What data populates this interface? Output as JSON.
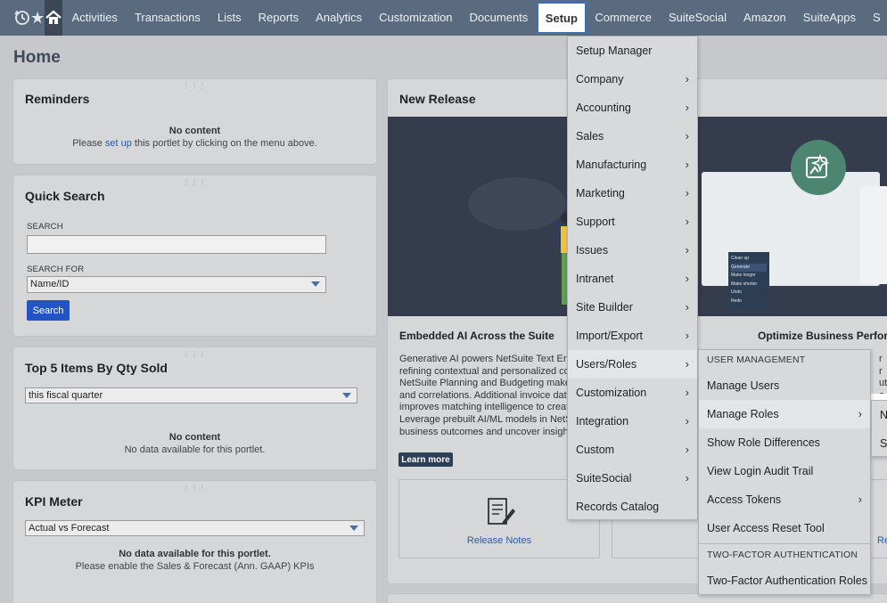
{
  "nav": {
    "items": [
      "Activities",
      "Transactions",
      "Lists",
      "Reports",
      "Analytics",
      "Customization",
      "Documents",
      "Setup",
      "Commerce",
      "SuiteSocial",
      "Amazon",
      "SuiteApps",
      "S"
    ],
    "active": "Setup"
  },
  "page": {
    "title": "Home"
  },
  "reminders": {
    "title": "Reminders",
    "no_content": "No content",
    "hint_prefix": "Please ",
    "hint_link": "set up",
    "hint_suffix": " this portlet by clicking on the menu above."
  },
  "quick_search": {
    "title": "Quick Search",
    "search_label": "SEARCH",
    "search_value": "",
    "search_for_label": "SEARCH FOR",
    "search_for_value": "Name/ID",
    "button": "Search"
  },
  "top_items": {
    "title": "Top 5 Items By Qty Sold",
    "period": "this fiscal quarter",
    "no_content": "No content",
    "no_data": "No data available for this portlet."
  },
  "kpi": {
    "title": "KPI Meter",
    "select": "Actual vs Forecast",
    "no_data": "No data available for this portlet.",
    "hint": "Please enable the Sales & Forecast (Ann. GAAP) KPIs"
  },
  "new_release": {
    "title": "New Release",
    "popup_items": [
      "Clean up",
      "Generate",
      "Make longer",
      "Make shorter",
      "Undo",
      "Redo"
    ],
    "col1_title": "Embedded AI Across the Suite",
    "col1_lines": [
      "Generative AI powers NetSuite Text Enh",
      "refining contextual and personalized co",
      "NetSuite Planning and Budgeting make",
      "and correlations. Additional invoice dat",
      "improves matching intelligence to creat",
      "Leverage prebuilt AI/ML models in NetS",
      "business outcomes and uncover insight"
    ],
    "col2_title": "Optimize Business Perforr",
    "col2_lines": [
      "r",
      "r",
      "ution",
      "e Cl"
    ],
    "learn_more": "Learn more",
    "release_notes": "Release Notes",
    "card3_text": "Re"
  },
  "setup_menu": {
    "items": [
      {
        "label": "Setup Manager",
        "sub": false
      },
      {
        "label": "Company",
        "sub": true
      },
      {
        "label": "Accounting",
        "sub": true
      },
      {
        "label": "Sales",
        "sub": true
      },
      {
        "label": "Manufacturing",
        "sub": true
      },
      {
        "label": "Marketing",
        "sub": true
      },
      {
        "label": "Support",
        "sub": true
      },
      {
        "label": "Issues",
        "sub": true
      },
      {
        "label": "Intranet",
        "sub": true
      },
      {
        "label": "Site Builder",
        "sub": true
      },
      {
        "label": "Import/Export",
        "sub": true
      },
      {
        "label": "Users/Roles",
        "sub": true
      },
      {
        "label": "Customization",
        "sub": true
      },
      {
        "label": "Integration",
        "sub": true
      },
      {
        "label": "Custom",
        "sub": true
      },
      {
        "label": "SuiteSocial",
        "sub": true
      },
      {
        "label": "Records Catalog",
        "sub": false
      }
    ],
    "highlighted": "Users/Roles"
  },
  "users_menu": {
    "header1": "USER MANAGEMENT",
    "items1": [
      {
        "label": "Manage Users",
        "sub": false
      },
      {
        "label": "Manage Roles",
        "sub": true
      },
      {
        "label": "Show Role Differences",
        "sub": false
      },
      {
        "label": "View Login Audit Trail",
        "sub": false
      },
      {
        "label": "Access Tokens",
        "sub": true
      },
      {
        "label": "User Access Reset Tool",
        "sub": false
      }
    ],
    "header2": "TWO-FACTOR AUTHENTICATION",
    "items2": [
      {
        "label": "Two-Factor Authentication Roles",
        "sub": false
      }
    ],
    "highlighted": "Manage Roles"
  },
  "roles_submenu": {
    "items": [
      "N",
      "Se"
    ]
  }
}
